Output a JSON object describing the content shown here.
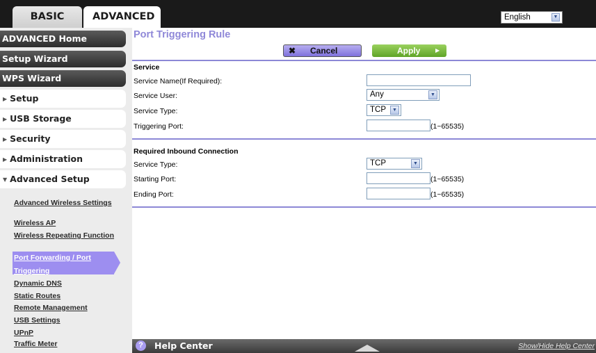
{
  "tabs": {
    "basic": "BASIC",
    "advanced": "ADVANCED"
  },
  "language": {
    "selected": "English"
  },
  "sidebar": {
    "main_items": [
      "ADVANCED Home",
      "Setup Wizard",
      "WPS Wizard"
    ],
    "sections": [
      "Setup",
      "USB Storage",
      "Security",
      "Administration",
      "Advanced Setup"
    ],
    "sub_items": [
      "Advanced Wireless Settings",
      "Wireless AP",
      "Wireless Repeating Function",
      "Port Forwarding / Port Triggering",
      "Dynamic DNS",
      "Static Routes",
      "Remote Management",
      "USB Settings",
      "UPnP",
      "Traffic Meter"
    ]
  },
  "page": {
    "title": "Port Triggering Rule",
    "cancel_label": "Cancel",
    "apply_label": "Apply"
  },
  "service": {
    "heading": "Service",
    "name_label": "Service Name(If Required):",
    "name_value": "",
    "user_label": "Service User:",
    "user_value": "Any",
    "type_label": "Service Type:",
    "type_value": "TCP",
    "port_label": "Triggering Port:",
    "port_value": "",
    "port_hint": "(1~65535)"
  },
  "inbound": {
    "heading": "Required Inbound Connection",
    "type_label": "Service Type:",
    "type_value": "TCP",
    "start_label": "Starting Port:",
    "start_value": "",
    "start_hint": "(1~65535)",
    "end_label": "Ending Port:",
    "end_value": "",
    "end_hint": "(1~65535)"
  },
  "help": {
    "title": "Help Center",
    "toggle": "Show/Hide Help Center"
  },
  "colors": {
    "accent": "#8f88d8",
    "apply": "#6fb333",
    "active_nav": "#9d8ef0",
    "dark": "#1a1a1a"
  }
}
